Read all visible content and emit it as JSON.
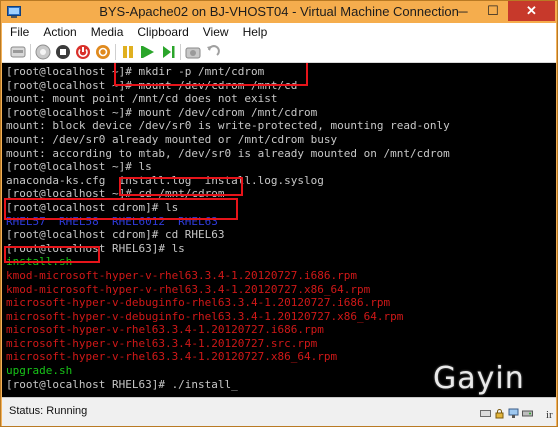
{
  "window": {
    "title": "BYS-Apache02 on BJ-VHOST04 - Virtual Machine Connection",
    "app_icon": "vm-connection-icon",
    "caption_buttons": {
      "minimize": "─",
      "maximize": "☐",
      "close": "✕"
    }
  },
  "menu": [
    "File",
    "Action",
    "Media",
    "Clipboard",
    "View",
    "Help"
  ],
  "toolbar": {
    "icons": [
      "ctrl-alt-del-icon",
      "start-icon",
      "turn-off-icon",
      "shut-down-icon",
      "save-state-icon",
      "pause-icon",
      "resume-icon",
      "reset-icon",
      "snapshot-icon",
      "revert-icon"
    ]
  },
  "terminal": {
    "lines": [
      {
        "text": "[root@localhost ~]# mkdir -p /mnt/cdrom",
        "style": "default"
      },
      {
        "text": "[root@localhost ~]# mount /dev/cdrom /mnt/cd",
        "style": "default"
      },
      {
        "text": "mount: mount point /mnt/cd does not exist",
        "style": "default"
      },
      {
        "text": "[root@localhost ~]# mount /dev/cdrom /mnt/cdrom",
        "style": "default"
      },
      {
        "text": "mount: block device /dev/sr0 is write-protected, mounting read-only",
        "style": "default"
      },
      {
        "text": "mount: /dev/sr0 already mounted or /mnt/cdrom busy",
        "style": "default"
      },
      {
        "text": "mount: according to mtab, /dev/sr0 is already mounted on /mnt/cdrom",
        "style": "default"
      },
      {
        "text": "[root@localhost ~]# ls",
        "style": "default"
      },
      {
        "text": "anaconda-ks.cfg  install.log  install.log.syslog",
        "style": "default"
      },
      {
        "text": "[root@localhost ~]# cd /mnt/cdrom",
        "style": "default"
      },
      {
        "text": "[root@localhost cdrom]# ls",
        "style": "default"
      },
      {
        "text": "RHEL57  RHEL58  RHEL6012  RHEL63",
        "style": "blue"
      },
      {
        "text": "[root@localhost cdrom]# cd RHEL63",
        "style": "default"
      },
      {
        "text": "[root@localhost RHEL63]# ls",
        "style": "default"
      },
      {
        "text": "install.sh",
        "style": "green"
      },
      {
        "text": "kmod-microsoft-hyper-v-rhel63.3.4-1.20120727.i686.rpm",
        "style": "red"
      },
      {
        "text": "kmod-microsoft-hyper-v-rhel63.3.4-1.20120727.x86_64.rpm",
        "style": "red"
      },
      {
        "text": "microsoft-hyper-v-debuginfo-rhel63.3.4-1.20120727.i686.rpm",
        "style": "red"
      },
      {
        "text": "microsoft-hyper-v-debuginfo-rhel63.3.4-1.20120727.x86_64.rpm",
        "style": "red"
      },
      {
        "text": "microsoft-hyper-v-rhel63.3.4-1.20120727.i686.rpm",
        "style": "red"
      },
      {
        "text": "microsoft-hyper-v-rhel63.3.4-1.20120727.src.rpm",
        "style": "red"
      },
      {
        "text": "microsoft-hyper-v-rhel63.3.4-1.20120727.x86_64.rpm",
        "style": "red"
      },
      {
        "text": "upgrade.sh",
        "style": "green"
      },
      {
        "text": "[root@localhost RHEL63]# ./install",
        "style": "default",
        "cursor": "_"
      }
    ]
  },
  "watermark": "Gayin",
  "status": {
    "text": "Status: Running",
    "icons": [
      "keyboard-icon",
      "lock-icon",
      "network-icon",
      "disk-icon"
    ]
  },
  "edge_mark": "ir",
  "colors": {
    "annotation_red": "#e6141a",
    "window_frame": "#f4b25a",
    "terminal_bg": "#000000"
  }
}
